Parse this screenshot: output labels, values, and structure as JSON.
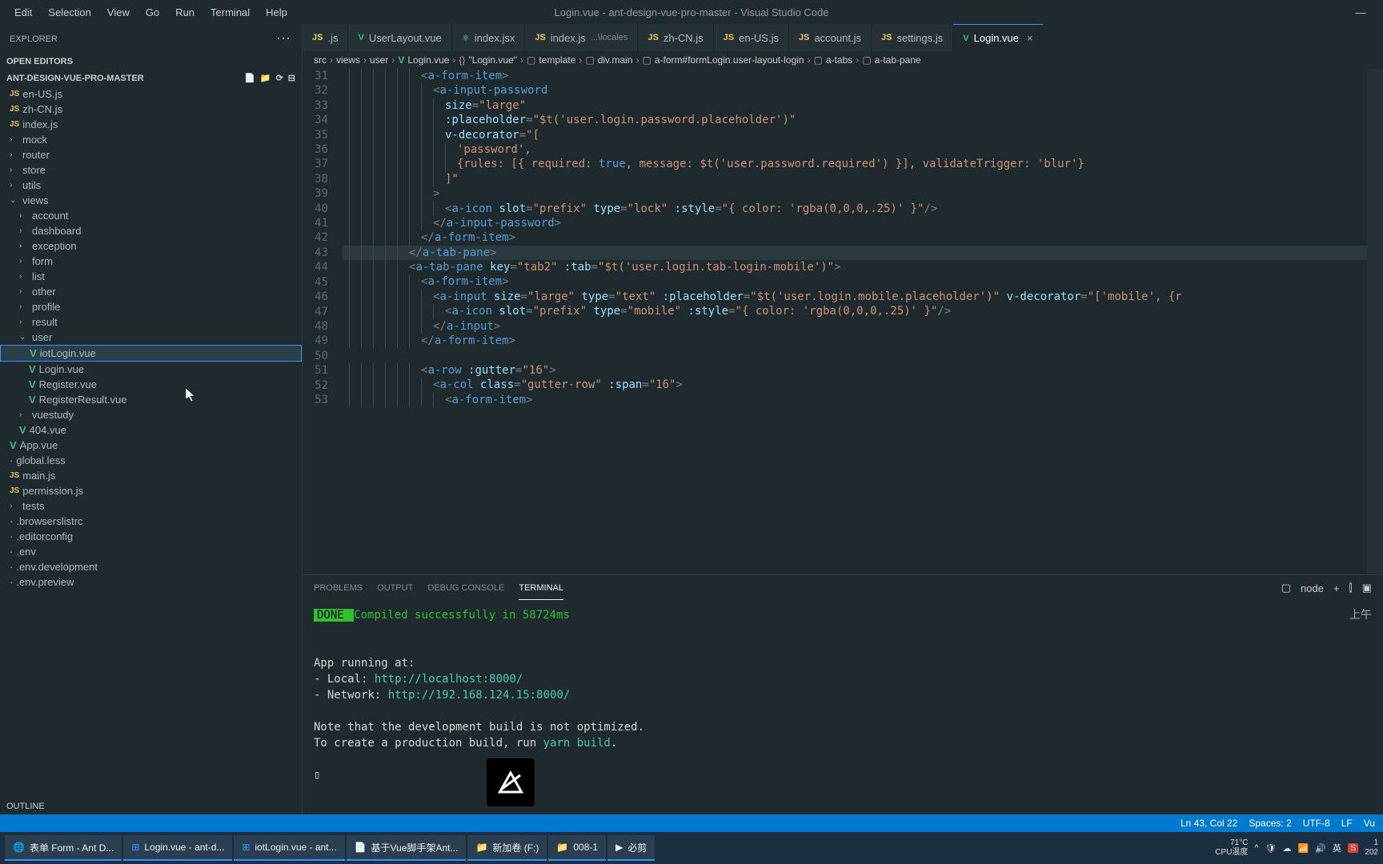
{
  "menu": [
    "Edit",
    "Selection",
    "View",
    "Go",
    "Run",
    "Terminal",
    "Help"
  ],
  "window_title": "Login.vue - ant-design-vue-pro-master - Visual Studio Code",
  "explorer": {
    "title": "EXPLORER",
    "open_editors": "OPEN EDITORS",
    "project": "ANT-DESIGN-VUE-PRO-MASTER",
    "outline": "OUTLINE"
  },
  "tree": {
    "items": [
      {
        "indent": 1,
        "icon": "js",
        "label": "en-US.js"
      },
      {
        "indent": 1,
        "icon": "js",
        "label": "zh-CN.js"
      },
      {
        "indent": 1,
        "icon": "js",
        "label": "index.js"
      },
      {
        "indent": 1,
        "icon": "chev",
        "label": "mock"
      },
      {
        "indent": 1,
        "icon": "chev",
        "label": "router"
      },
      {
        "indent": 1,
        "icon": "chev",
        "label": "store"
      },
      {
        "indent": 1,
        "icon": "chev",
        "label": "utils"
      },
      {
        "indent": 1,
        "icon": "chev-open",
        "label": "views"
      },
      {
        "indent": 2,
        "icon": "chev",
        "label": "account"
      },
      {
        "indent": 2,
        "icon": "chev",
        "label": "dashboard"
      },
      {
        "indent": 2,
        "icon": "chev",
        "label": "exception"
      },
      {
        "indent": 2,
        "icon": "chev",
        "label": "form"
      },
      {
        "indent": 2,
        "icon": "chev",
        "label": "list"
      },
      {
        "indent": 2,
        "icon": "chev",
        "label": "other"
      },
      {
        "indent": 2,
        "icon": "chev",
        "label": "profile"
      },
      {
        "indent": 2,
        "icon": "chev",
        "label": "result"
      },
      {
        "indent": 2,
        "icon": "chev-open",
        "label": "user"
      },
      {
        "indent": 3,
        "icon": "vue",
        "label": "iotLogin.vue",
        "selected": true
      },
      {
        "indent": 3,
        "icon": "vue",
        "label": "Login.vue"
      },
      {
        "indent": 3,
        "icon": "vue",
        "label": "Register.vue"
      },
      {
        "indent": 3,
        "icon": "vue",
        "label": "RegisterResult.vue"
      },
      {
        "indent": 2,
        "icon": "chev",
        "label": "vuestudy"
      },
      {
        "indent": 2,
        "icon": "vue",
        "label": "404.vue"
      },
      {
        "indent": 1,
        "icon": "vue",
        "label": "App.vue"
      },
      {
        "indent": 1,
        "icon": "file",
        "label": "global.less"
      },
      {
        "indent": 1,
        "icon": "js",
        "label": "main.js"
      },
      {
        "indent": 1,
        "icon": "js",
        "label": "permission.js"
      },
      {
        "indent": 1,
        "icon": "chev",
        "label": "tests"
      },
      {
        "indent": 1,
        "icon": "file",
        "label": ".browserslistrc"
      },
      {
        "indent": 1,
        "icon": "file",
        "label": ".editorconfig"
      },
      {
        "indent": 1,
        "icon": "file",
        "label": ".env"
      },
      {
        "indent": 1,
        "icon": "file",
        "label": ".env.development"
      },
      {
        "indent": 1,
        "icon": "file",
        "label": ".env.preview"
      }
    ]
  },
  "tabs": [
    {
      "icon": "js",
      "label": ".js"
    },
    {
      "icon": "vue",
      "label": "UserLayout.vue"
    },
    {
      "icon": "react",
      "label": "index.jsx"
    },
    {
      "icon": "js",
      "label": "index.js",
      "suffix": "...\\locales"
    },
    {
      "icon": "js",
      "label": "zh-CN.js"
    },
    {
      "icon": "js",
      "label": "en-US.js"
    },
    {
      "icon": "js",
      "label": "account.js"
    },
    {
      "icon": "js",
      "label": "settings.js"
    },
    {
      "icon": "vue",
      "label": "Login.vue",
      "active": true
    }
  ],
  "breadcrumb": [
    "src",
    "views",
    "user",
    "Login.vue",
    "\"Login.vue\"",
    "template",
    "div.main",
    "a-form#formLogin.user-layout-login",
    "a-tabs",
    "a-tab-pane"
  ],
  "code_lines": [
    {
      "n": 31,
      "indent": 6,
      "html": "<span class='t-punc'>&lt;</span><span class='t-tag'>a-form-item</span><span class='t-punc'>&gt;</span>"
    },
    {
      "n": 32,
      "indent": 7,
      "html": "<span class='t-punc'>&lt;</span><span class='t-tag'>a-input-password</span>"
    },
    {
      "n": 33,
      "indent": 8,
      "html": "<span class='t-attr'>size</span><span class='t-punc'>=</span><span class='t-string'>\"large\"</span>"
    },
    {
      "n": 34,
      "indent": 8,
      "html": "<span class='t-attr'>:placeholder</span><span class='t-punc'>=</span><span class='t-string'>\"$t('user.login.password.placeholder')\"</span>"
    },
    {
      "n": 35,
      "indent": 8,
      "html": "<span class='t-attr'>v-decorator</span><span class='t-punc'>=</span><span class='t-string'>\"[</span>"
    },
    {
      "n": 36,
      "indent": 9,
      "html": "<span class='t-string'>'password',</span>"
    },
    {
      "n": 37,
      "indent": 9,
      "html": "<span class='t-string'>{rules: [{ required: </span><span class='t-const'>true</span><span class='t-string'>, message: $t('user.password.required') }], validateTrigger: 'blur'}</span>"
    },
    {
      "n": 38,
      "indent": 8,
      "html": "<span class='t-string'>]\"</span>"
    },
    {
      "n": 39,
      "indent": 7,
      "html": "<span class='t-punc'>&gt;</span>"
    },
    {
      "n": 40,
      "indent": 8,
      "html": "<span class='t-punc'>&lt;</span><span class='t-tag'>a-icon</span> <span class='t-attr'>slot</span><span class='t-punc'>=</span><span class='t-string'>\"prefix\"</span> <span class='t-attr'>type</span><span class='t-punc'>=</span><span class='t-string'>\"lock\"</span> <span class='t-attr'>:style</span><span class='t-punc'>=</span><span class='t-string'>\"{ color: 'rgba(0,0,0,.25)' }\"</span><span class='t-punc'>/&gt;</span>"
    },
    {
      "n": 41,
      "indent": 7,
      "html": "<span class='t-punc'>&lt;/</span><span class='t-tag'>a-input-password</span><span class='t-punc'>&gt;</span>"
    },
    {
      "n": 42,
      "indent": 6,
      "html": "<span class='t-punc'>&lt;/</span><span class='t-tag'>a-form-item</span><span class='t-punc'>&gt;</span>"
    },
    {
      "n": 43,
      "indent": 5,
      "html": "<span class='t-punc'>&lt;/</span><span class='t-tag'>a-tab-pane</span><span class='t-punc'>&gt;</span>",
      "highlight": true
    },
    {
      "n": 44,
      "indent": 5,
      "html": "<span class='t-punc'>&lt;</span><span class='t-tag'>a-tab-pane</span> <span class='t-attr'>key</span><span class='t-punc'>=</span><span class='t-string'>\"tab2\"</span> <span class='t-attr'>:tab</span><span class='t-punc'>=</span><span class='t-string'>\"$t('user.login.tab-login-mobile')\"</span><span class='t-punc'>&gt;</span>"
    },
    {
      "n": 45,
      "indent": 6,
      "html": "<span class='t-punc'>&lt;</span><span class='t-tag'>a-form-item</span><span class='t-punc'>&gt;</span>"
    },
    {
      "n": 46,
      "indent": 7,
      "html": "<span class='t-punc'>&lt;</span><span class='t-tag'>a-input</span> <span class='t-attr'>size</span><span class='t-punc'>=</span><span class='t-string'>\"large\"</span> <span class='t-attr'>type</span><span class='t-punc'>=</span><span class='t-string'>\"text\"</span> <span class='t-attr'>:placeholder</span><span class='t-punc'>=</span><span class='t-string'>\"$t('user.login.mobile.placeholder')\"</span> <span class='t-attr'>v-decorator</span><span class='t-punc'>=</span><span class='t-string'>\"['mobile', {r</span>"
    },
    {
      "n": 47,
      "indent": 8,
      "html": "<span class='t-punc'>&lt;</span><span class='t-tag'>a-icon</span> <span class='t-attr'>slot</span><span class='t-punc'>=</span><span class='t-string'>\"prefix\"</span> <span class='t-attr'>type</span><span class='t-punc'>=</span><span class='t-string'>\"mobile\"</span> <span class='t-attr'>:style</span><span class='t-punc'>=</span><span class='t-string'>\"{ color: 'rgba(0,0,0,.25)' }\"</span><span class='t-punc'>/&gt;</span>"
    },
    {
      "n": 48,
      "indent": 7,
      "html": "<span class='t-punc'>&lt;/</span><span class='t-tag'>a-input</span><span class='t-punc'>&gt;</span>"
    },
    {
      "n": 49,
      "indent": 6,
      "html": "<span class='t-punc'>&lt;/</span><span class='t-tag'>a-form-item</span><span class='t-punc'>&gt;</span>"
    },
    {
      "n": 50,
      "indent": 0,
      "html": ""
    },
    {
      "n": 51,
      "indent": 6,
      "html": "<span class='t-punc'>&lt;</span><span class='t-tag'>a-row</span> <span class='t-attr'>:gutter</span><span class='t-punc'>=</span><span class='t-string'>\"16\"</span><span class='t-punc'>&gt;</span>"
    },
    {
      "n": 52,
      "indent": 7,
      "html": "<span class='t-punc'>&lt;</span><span class='t-tag'>a-col</span> <span class='t-attr'>class</span><span class='t-punc'>=</span><span class='t-string'>\"gutter-row\"</span> <span class='t-attr'>:span</span><span class='t-punc'>=</span><span class='t-string'>\"16\"</span><span class='t-punc'>&gt;</span>"
    },
    {
      "n": 53,
      "indent": 8,
      "html": "<span class='t-punc'>&lt;</span><span class='t-tag'>a-form-item</span><span class='t-punc'>&gt;</span>"
    }
  ],
  "panel": {
    "tabs": [
      "PROBLEMS",
      "OUTPUT",
      "DEBUG CONSOLE",
      "TERMINAL"
    ],
    "active": "TERMINAL",
    "shell": "node",
    "topright": "上午"
  },
  "terminal": {
    "done": " DONE ",
    "compiled": " Compiled successfully in 58724ms",
    "running": "  App running at:",
    "local_label": "  - Local:   ",
    "local_url": "http://localhost:",
    "local_port": "8000",
    "net_label": "  - Network: ",
    "net_url": "http://192.168.124.15:",
    "net_port": "8000",
    "note1": "  Note that the development build is not optimized.",
    "note2": "  To create a production build, run ",
    "yarn": "yarn build",
    "dot": ".",
    "prompt": "▯"
  },
  "statusbar": {
    "right": [
      "Ln 43, Col 22",
      "Spaces: 2",
      "UTF-8",
      "LF",
      "Vu"
    ]
  },
  "taskbar": {
    "items": [
      {
        "icon": "chrome",
        "label": "表单 Form - Ant D..."
      },
      {
        "icon": "vscode",
        "label": "Login.vue - ant-d..."
      },
      {
        "icon": "vscode",
        "label": "iotLogin.vue - ant..."
      },
      {
        "icon": "doc",
        "label": "基于Vue脚手架Ant..."
      },
      {
        "icon": "folder",
        "label": "新加卷 (F:)"
      },
      {
        "icon": "folder",
        "label": "008-1"
      },
      {
        "icon": "app",
        "label": "必剪"
      }
    ],
    "temp": "71°C",
    "temp_label": "CPU温度",
    "time": "1",
    "date": "202"
  }
}
